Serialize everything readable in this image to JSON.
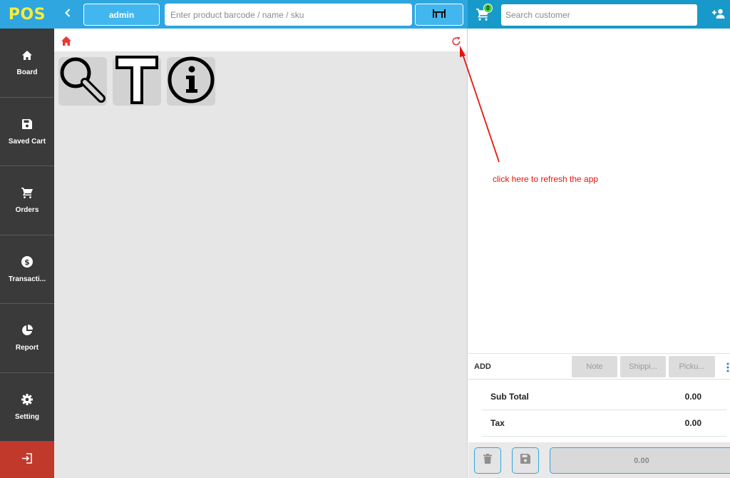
{
  "app": {
    "logo": "POS"
  },
  "sidebar": {
    "items": [
      {
        "label": "Board",
        "icon": "home-icon"
      },
      {
        "label": "Saved Cart",
        "icon": "floppy-icon"
      },
      {
        "label": "Orders",
        "icon": "cart-icon"
      },
      {
        "label": "Transacti...",
        "icon": "dollar-icon"
      },
      {
        "label": "Report",
        "icon": "pie-chart-icon"
      },
      {
        "label": "Setting",
        "icon": "gear-icon"
      }
    ],
    "logout_icon": "logout-icon"
  },
  "topbar": {
    "user_label": "admin",
    "product_search_placeholder": "Enter product barcode / name / sku"
  },
  "customer": {
    "cart_count": "0",
    "search_placeholder": "Search customer"
  },
  "main": {
    "tiles": [
      {
        "icon": "magnifier-icon"
      },
      {
        "icon": "text-tool-icon"
      },
      {
        "icon": "info-icon"
      }
    ]
  },
  "annotation": {
    "text": "click here to refresh the app",
    "color": "#e8140c"
  },
  "cart": {
    "add_label": "ADD",
    "buttons": [
      "Note",
      "Shippi...",
      "Picku..."
    ],
    "subtotal_label": "Sub Total",
    "subtotal_value": "0.00",
    "tax_label": "Tax",
    "tax_value": "0.00",
    "pay_label": "0.00"
  },
  "colors": {
    "header_blue": "#2fa6df",
    "header_dark_blue": "#1799c9",
    "sidebar": "#3a3a3a",
    "logout": "#c0392b",
    "logo_yellow": "#f7ec3a",
    "accent_red": "#e8140c"
  }
}
